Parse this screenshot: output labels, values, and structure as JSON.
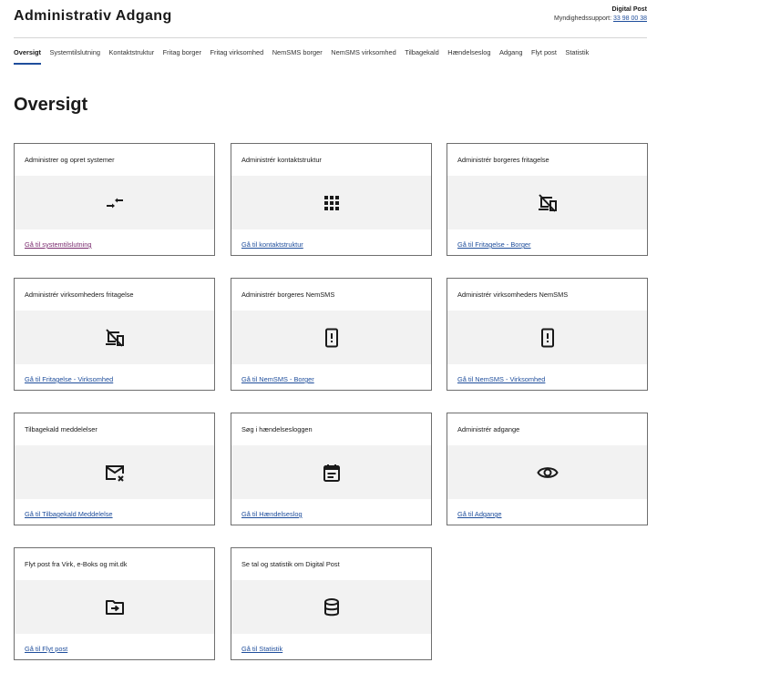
{
  "header": {
    "title": "Administrativ Adgang",
    "brand": "Digital Post",
    "support_label": "Myndighedssupport: ",
    "support_phone": "33 98 00 38"
  },
  "nav": {
    "items": [
      {
        "label": "Oversigt",
        "active": true
      },
      {
        "label": "Systemtilslutning"
      },
      {
        "label": "Kontaktstruktur"
      },
      {
        "label": "Fritag borger"
      },
      {
        "label": "Fritag virksomhed"
      },
      {
        "label": "NemSMS borger"
      },
      {
        "label": "NemSMS virksomhed"
      },
      {
        "label": "Tilbagekald"
      },
      {
        "label": "Hændelseslog"
      },
      {
        "label": "Adgang"
      },
      {
        "label": "Flyt post"
      },
      {
        "label": "Statistik"
      }
    ]
  },
  "page": {
    "title": "Oversigt"
  },
  "cards": [
    {
      "title": "Administrer og opret systemer",
      "link": "Gå til systemtilslutning",
      "icon": "swap-arrows-icon"
    },
    {
      "title": "Administrér kontaktstruktur",
      "link": "Gå til kontaktstruktur",
      "icon": "grid-icon"
    },
    {
      "title": "Administrér borgeres fritagelse",
      "link": "Gå til Fritagelse - Borger",
      "icon": "devices-off-icon"
    },
    {
      "title": "Administrér virksomheders fritagelse",
      "link": "Gå til Fritagelse - Virksomhed",
      "icon": "devices-off-icon"
    },
    {
      "title": "Administrér borgeres NemSMS",
      "link": "Gå til NemSMS - Borger",
      "icon": "phone-alert-icon"
    },
    {
      "title": "Administrér virksomheders NemSMS",
      "link": "Gå til NemSMS - Virksomhed",
      "icon": "phone-alert-icon"
    },
    {
      "title": "Tilbagekald meddelelser",
      "link": "Gå til Tilbagekald Meddelelse",
      "icon": "mail-cancel-icon"
    },
    {
      "title": "Søg i hændelsesloggen",
      "link": "Gå til Hændelseslog",
      "icon": "calendar-log-icon"
    },
    {
      "title": "Administrér adgange",
      "link": "Gå til Adgange",
      "icon": "eye-icon"
    },
    {
      "title": "Flyt post fra Virk, e-Boks og mit.dk",
      "link": "Gå til Flyt post",
      "icon": "folder-move-icon"
    },
    {
      "title": "Se tal og statistik om Digital Post",
      "link": "Gå til Statistik",
      "icon": "database-icon"
    }
  ],
  "colors": {
    "link": "#1f4e9c",
    "visited_link": "#7a2a6e",
    "card_border": "#6e6e6e",
    "band": "#f2f2f2"
  }
}
